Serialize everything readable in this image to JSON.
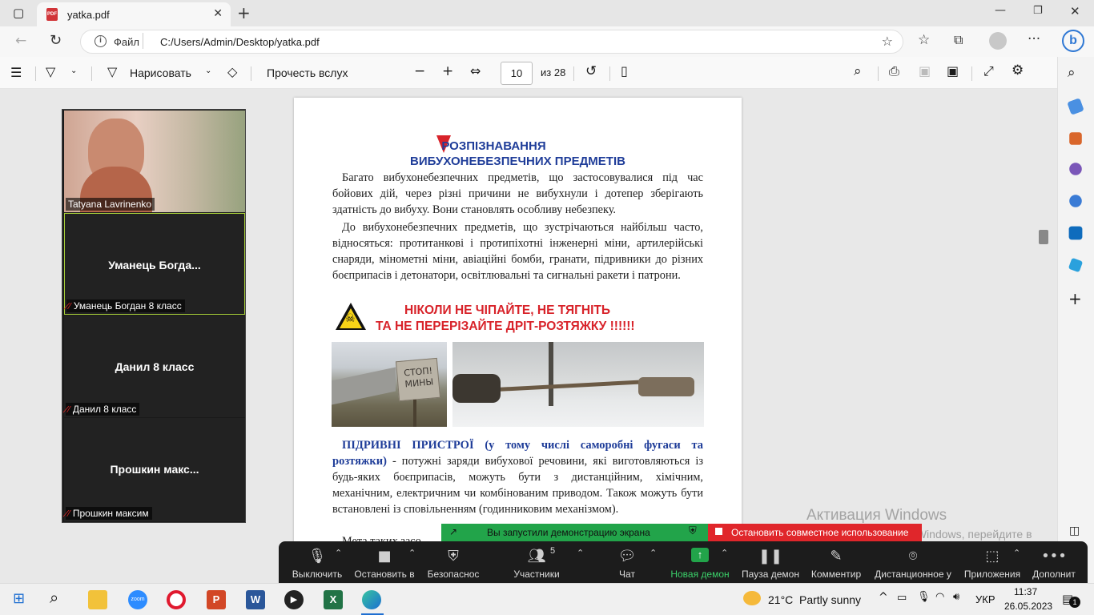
{
  "browser": {
    "tab_title": "yatka.pdf",
    "new_tab": "+",
    "address_label": "Файл",
    "address_url": "C:/Users/Admin/Desktop/yatka.pdf"
  },
  "pdf_toolbar": {
    "draw_label": "Нарисовать",
    "read_aloud_label": "Прочесть вслух",
    "page_current": "10",
    "page_total": "из 28"
  },
  "document": {
    "title_line1": "РОЗПІЗНАВАННЯ",
    "title_line2": "ВИБУХОНЕБЕЗПЕЧНИХ ПРЕДМЕТІВ",
    "para1": "Багато вибухонебезпечних предметів, що застосовувалися під час бойових дій, через різні причини не вибухнули і дотепер зберігають здатність до вибуху. Вони становлять особливу небезпеку.",
    "para2": "До вибухонебезпечних предметів, що зустрічаються найбільш часто, відносяться: протитанкові і протипіхотні інженерні міни, артилерійські снаряди, мінометні міни, авіаційні бомби, гранати, підривники до різних боєприпасів і детонатори, освітлювальні та сигнальні ракети і патрони.",
    "warning_line1": "НІКОЛИ НЕ ЧІПАЙТЕ, НЕ ТЯГНІТЬ",
    "warning_line2": "ТА НЕ ПЕРЕРІЗАЙТЕ ДРІТ-РОЗТЯЖКУ  !!!!!!",
    "sign_text": "СТОП! МИНЫ",
    "para3_heading": "ПІДРИВНІ ПРИСТРОЇ (у тому числі саморобні фугаси та розтяжки)",
    "para3_body": " - потужні заряди вибухової речовини, які виготовляються із будь-яких боєприпасів, можуть бути з дистанційним, хімічним, механічним, електричним чи комбінованим приводом. Також можуть бути встановлені із сповільненням (годинниковим механізмом).",
    "para4_partial": "Мета таких засо"
  },
  "zoom": {
    "participants": [
      {
        "name_big": "",
        "label": "Tatyana Lavrinenko"
      },
      {
        "name_big": "Уманець  Богда...",
        "label": "Уманець Богдан 8 класс"
      },
      {
        "name_big": "Данил 8 класс",
        "label": "Данил 8 класс"
      },
      {
        "name_big": "Прошкин  макс...",
        "label": "Прошкин максим"
      }
    ],
    "share_notice": "Вы запустили демонстрацию экрана",
    "stop_share": "Остановить совместное использование",
    "toolbar": {
      "mute": "Выключить",
      "video": "Остановить в",
      "security": "Безопаснос",
      "participants": "Участники",
      "participants_count": "5",
      "chat": "Чат",
      "new_share": "Новая демон",
      "pause_share": "Пауза демон",
      "annotate": "Комментир",
      "remote": "Дистанционное у",
      "apps": "Приложения",
      "more": "Дополнит"
    }
  },
  "watermark": {
    "line1": "Активация Windows",
    "line2": "Чтобы активировать Windows, перейдите в раздел \"Параметры\"."
  },
  "taskbar": {
    "weather_temp": "21°C",
    "weather_desc": "Partly sunny",
    "lang": "УКР",
    "time": "11:37",
    "date": "26.05.2023",
    "notif_count": "1"
  },
  "colors": {
    "doc_blue": "#1f3d99",
    "doc_red": "#d8232a",
    "zoom_green": "#22a44a",
    "zoom_red": "#e0262b"
  }
}
